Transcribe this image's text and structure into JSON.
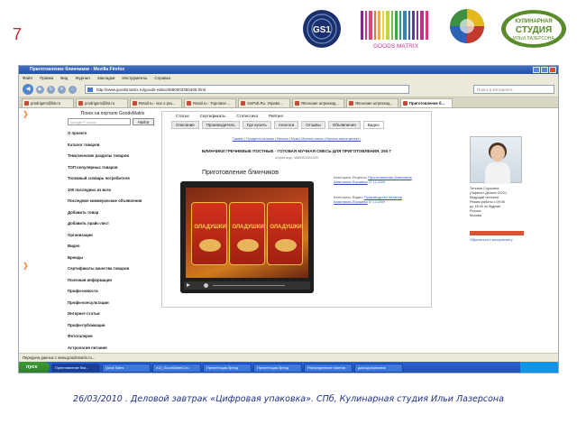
{
  "slide": {
    "number": "7",
    "footer": "26/03/2010 . Деловой завтрак «Цифровая упаковка». СПб, Кулинарная студия Ильи Лазерсона"
  },
  "logos": {
    "goods_matrix": "GOODS MATRIX",
    "studio_line1": "КУЛИНАРНАЯ",
    "studio_line2": "СТУДИЯ",
    "studio_line3": "ИЛЬИ ЛАЗЕРСОНА",
    "gs1": "GS1"
  },
  "browser": {
    "title": "Приготовление блинчиков - Mozilla Firefox",
    "menu": [
      "Файл",
      "Правка",
      "Вид",
      "Журнал",
      "Закладки",
      "Инструменты",
      "Справка"
    ],
    "url": "http://www.goodsmatrix.ru/goods-video/4680003350409.html",
    "search_placeholder": "Поиск в Интернете",
    "tabs": [
      "prodrigem@list.ru",
      "prodrigem@list.ru",
      "Retail.ru - все о роз...",
      "Retail.ru - Торговое ...",
      "SmPult.Ru. Управл...",
      "Японские штрихкод...",
      "Японские штрихкод...",
      "Приготовление б..."
    ],
    "status": "Передача данных с www.goodsmatrix.ru..."
  },
  "sidebar": {
    "title": "Поиск на портале GoodsMatrix",
    "search_placeholder": "Google™ поиск",
    "search_button": "Найти",
    "items": [
      "О проекте",
      "Каталог товаров",
      "Тематические разделы товаров",
      "ТОП популярных товаров",
      "Толковый словарь потребителя",
      "100 последних из всех",
      "Последние коммерческие объявления",
      "Добавить товар",
      "Добавить прайс-лист",
      "Организации",
      "Видео",
      "Бренды",
      "Сертификаты качества товаров",
      "Полезная информация",
      "Профи-новости",
      "Профи-консультации",
      "Интернет-статьи",
      "Профи-публикации",
      "Фотогалерея",
      "Астрология питания"
    ]
  },
  "content": {
    "top_tabs": [
      "Статьи",
      "Сертификаты",
      "Статистика",
      "Рейтинг"
    ],
    "sub_tabs": [
      "Описание",
      "Производитель",
      "Где купить",
      "Аналоги",
      "Отзывы",
      "Объявления",
      "Видео"
    ],
    "breadcrumbs": "Товары | Продукты питания | Мучные | Мука | Мучные смеси | Мучные смеси десерт |",
    "product_title": "БЛИНЧИКИ ГРЕЧНЕВЫЕ ПОСТНЫЕ - ГОТОВАЯ МУЧНАЯ СМЕСЬ ДЛЯ ПРИГОТОВЛЕНИЯ, 250 Г",
    "barcode": "Штрих-код: 4680003350409",
    "video_title": "Приготовление блинчиков",
    "video_label": "ОЛАДУШКИ",
    "videos": [
      {
        "category": "Категория: Рецепты",
        "link": "Приготовление блинчиков",
        "author": "Анастасия Лоршина",
        "date": "07.12.2009"
      },
      {
        "category": "Категория: Видео",
        "link": "Производство питания",
        "author": "Анастасия Лоршина",
        "date": "07.12.2009"
      }
    ]
  },
  "consultant": {
    "name": "Татьяна Сорокина",
    "details": [
      "(Лариопт-Дельта ООО)",
      "Ведущий технолог",
      "Режим работы с 09:00",
      "до 18:00 по будням",
      "Россия",
      "Москва"
    ],
    "links": [
      "Обратиться к консультанту"
    ]
  },
  "taskbar": {
    "start": "пуск",
    "tasks": [
      "Приготовление бли...",
      "Quick Sales",
      "e12_GoodsMatrix1.ru",
      "Презентация-бренд",
      "Презентация-бренд",
      "Распределение пакетов",
      "доклад компания"
    ]
  }
}
